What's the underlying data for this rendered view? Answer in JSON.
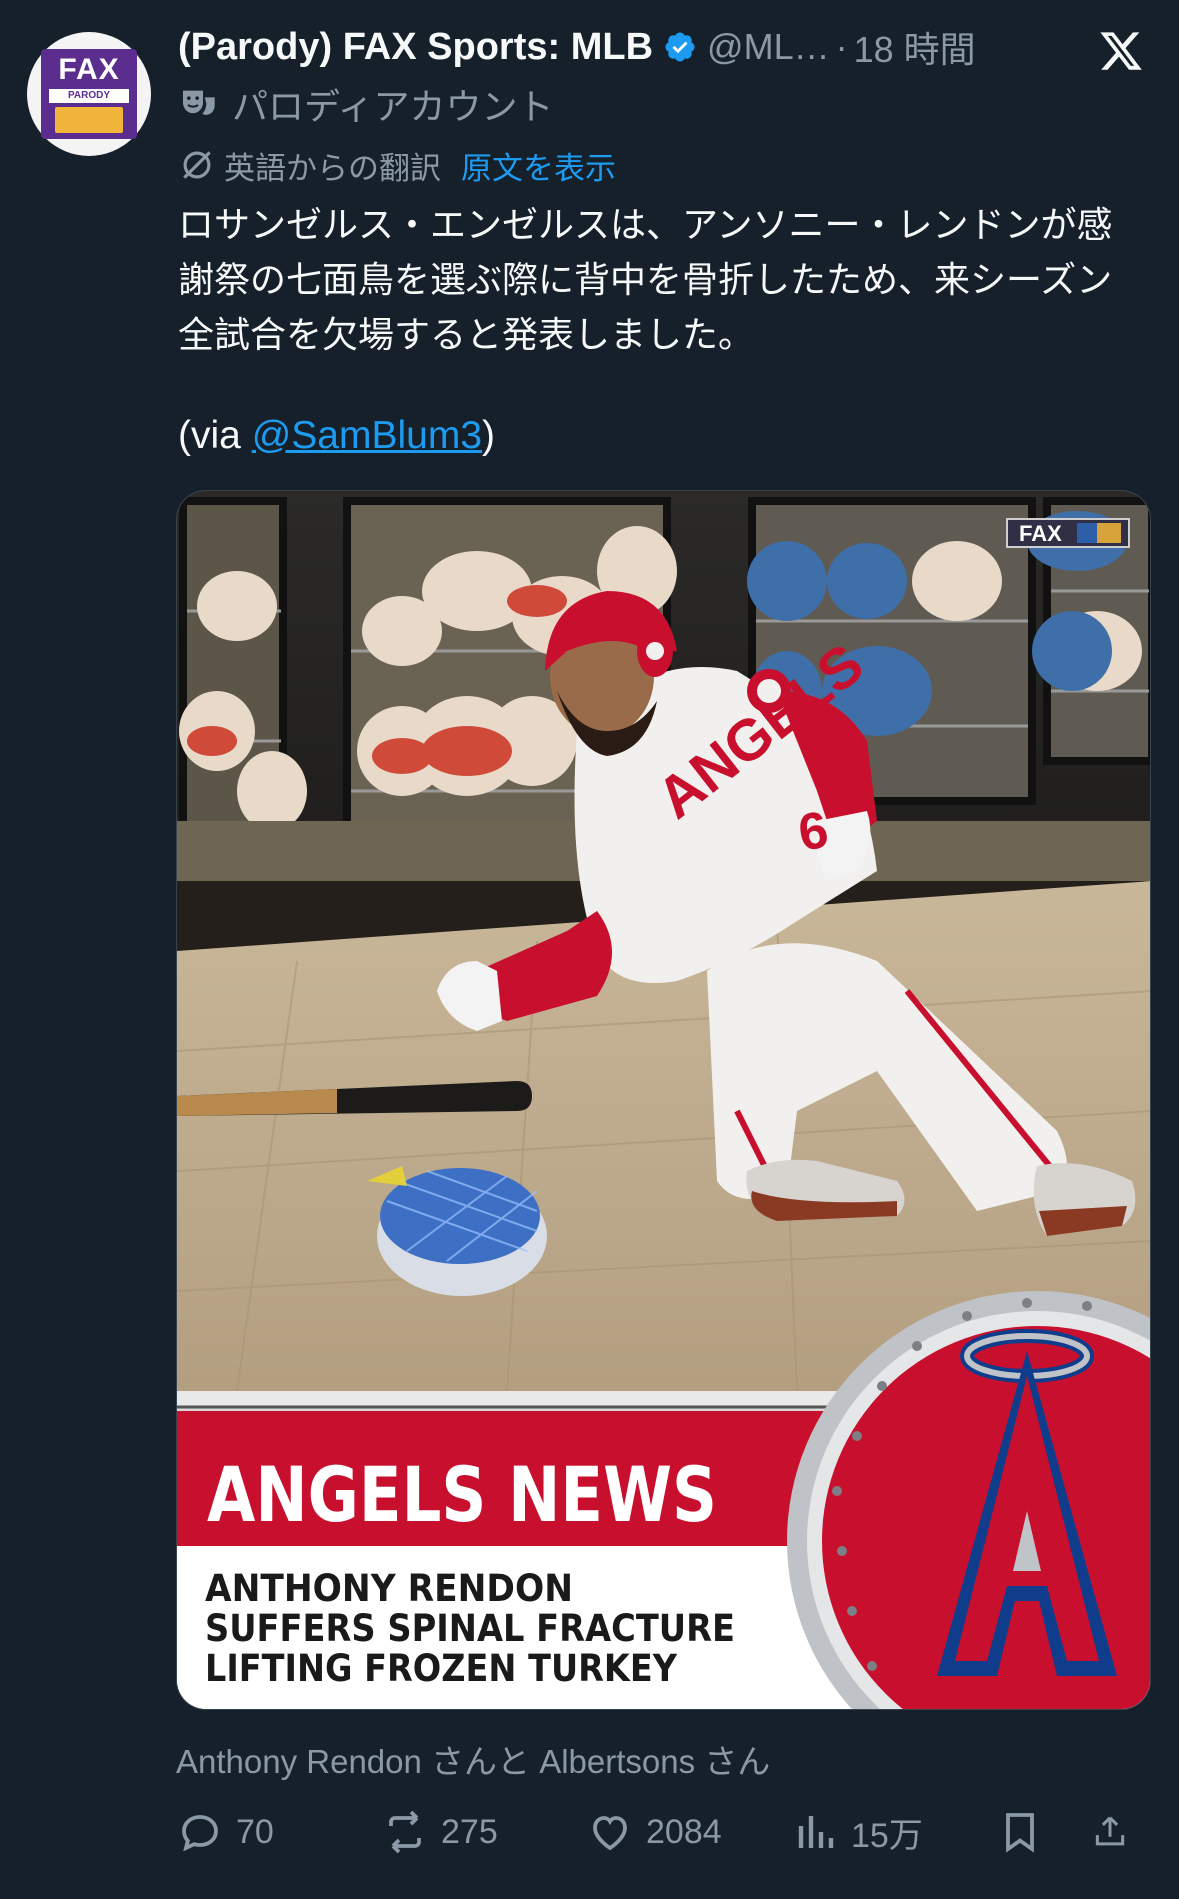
{
  "author": {
    "display_name": "(Parody) FAX Sports: MLB",
    "handle": "@ML…",
    "separator": "·",
    "time": "18 時間",
    "verified": true,
    "avatar_text": "FAX",
    "avatar_subtext": "PARODY",
    "parody_label": "パロディアカウント"
  },
  "translation": {
    "label": "英語からの翻訳",
    "show_original": "原文を表示"
  },
  "tweet": {
    "text": "ロサンゼルス・エンゼルスは、アンソニー・レンドンが感謝祭の七面鳥を選ぶ際に背中を骨折したため、来シーズン全試合を欠場すると発表しました。",
    "via_prefix": "(via ",
    "via_mention": "@SamBlum3",
    "via_suffix": ")"
  },
  "media": {
    "watermark": "FAX",
    "jersey_text": "ANGELS",
    "jersey_number": "6",
    "banner_title": "ANGELS NEWS",
    "headline_line1": "ANTHONY RENDON",
    "headline_line2": "SUFFERS SPINAL FRACTURE",
    "headline_line3": "LIFTING FROZEN TURKEY"
  },
  "tagged_caption": "Anthony Rendon さんと Albertsons さん",
  "actions": {
    "replies": "70",
    "reposts": "275",
    "likes": "2084",
    "views": "15万"
  },
  "colors": {
    "background": "#15202b",
    "text": "#f7f9f9",
    "secondary": "#8b98a5",
    "accent": "#1d9bf0",
    "angels_red": "#c8102e"
  }
}
